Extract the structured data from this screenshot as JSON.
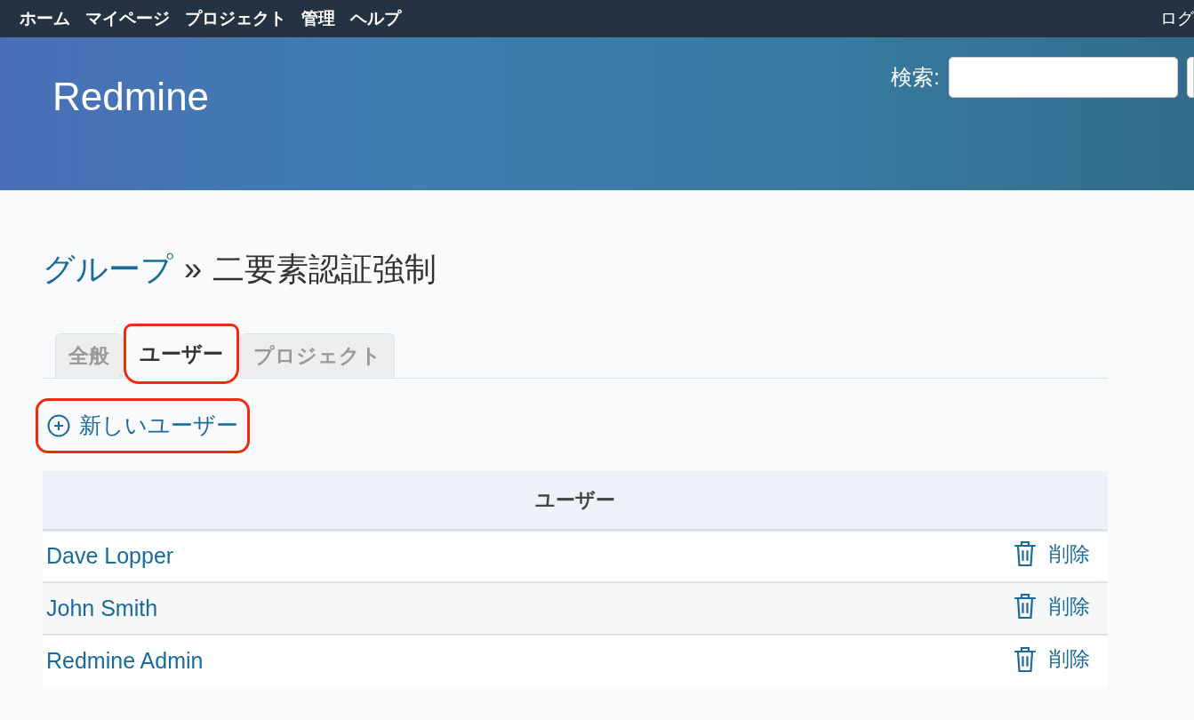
{
  "top_menu": [
    {
      "label": "ホーム"
    },
    {
      "label": "マイページ"
    },
    {
      "label": "プロジェクト"
    },
    {
      "label": "管理"
    },
    {
      "label": "ヘルプ"
    }
  ],
  "account": "ログ",
  "header": {
    "title": "Redmine",
    "search_label": "検索:"
  },
  "breadcrumb": {
    "link": "グループ",
    "separator": "»",
    "current": "二要素認証強制"
  },
  "tabs": [
    {
      "label": "全般",
      "selected": false,
      "highlighted": false
    },
    {
      "label": "ユーザー",
      "selected": true,
      "highlighted": true
    },
    {
      "label": "プロジェクト",
      "selected": false,
      "highlighted": false
    }
  ],
  "new_user": {
    "label": "新しいユーザー",
    "highlighted": true
  },
  "table": {
    "columns": [
      "ユーザー"
    ],
    "rows": [
      {
        "name": "Dave Lopper",
        "action": "削除"
      },
      {
        "name": "John Smith",
        "action": "削除"
      },
      {
        "name": "Redmine Admin",
        "action": "削除"
      }
    ]
  }
}
